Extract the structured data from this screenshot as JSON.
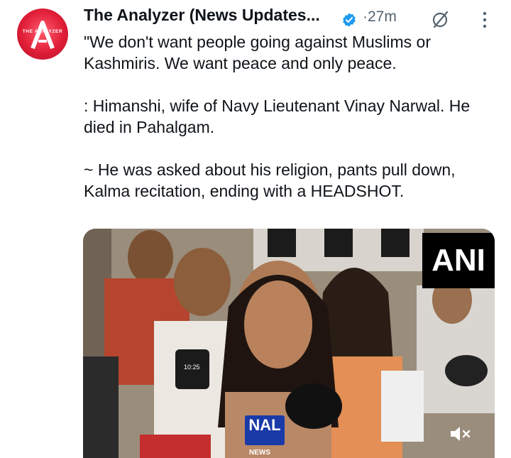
{
  "post": {
    "author_name": "The Analyzer (News Updates...",
    "avatar_text": "THE ANALYZER",
    "time": "·27m",
    "paragraphs": [
      "\"We don't want people going against Muslims or Kashmiris. We want peace and only peace.",
      ": Himanshi, wife of Navy Lieutenant Vinay Narwal. He died in Pahalgam.",
      "~ He was asked about his religion, pants pull down, Kalma recitation, ending with a HEADSHOT."
    ]
  },
  "media": {
    "watermark": "ANI",
    "mic_label": "NAL",
    "mic_sub": "NEWS",
    "phone_time": "10:25"
  },
  "colors": {
    "verified": "#1d9bf0",
    "avatar": "#e01e37",
    "muted_text": "#536471"
  },
  "icons": {
    "verified": "verified-badge-icon",
    "grok": "grok-icon",
    "more": "more-dots-icon",
    "mute": "volume-mute-icon"
  }
}
